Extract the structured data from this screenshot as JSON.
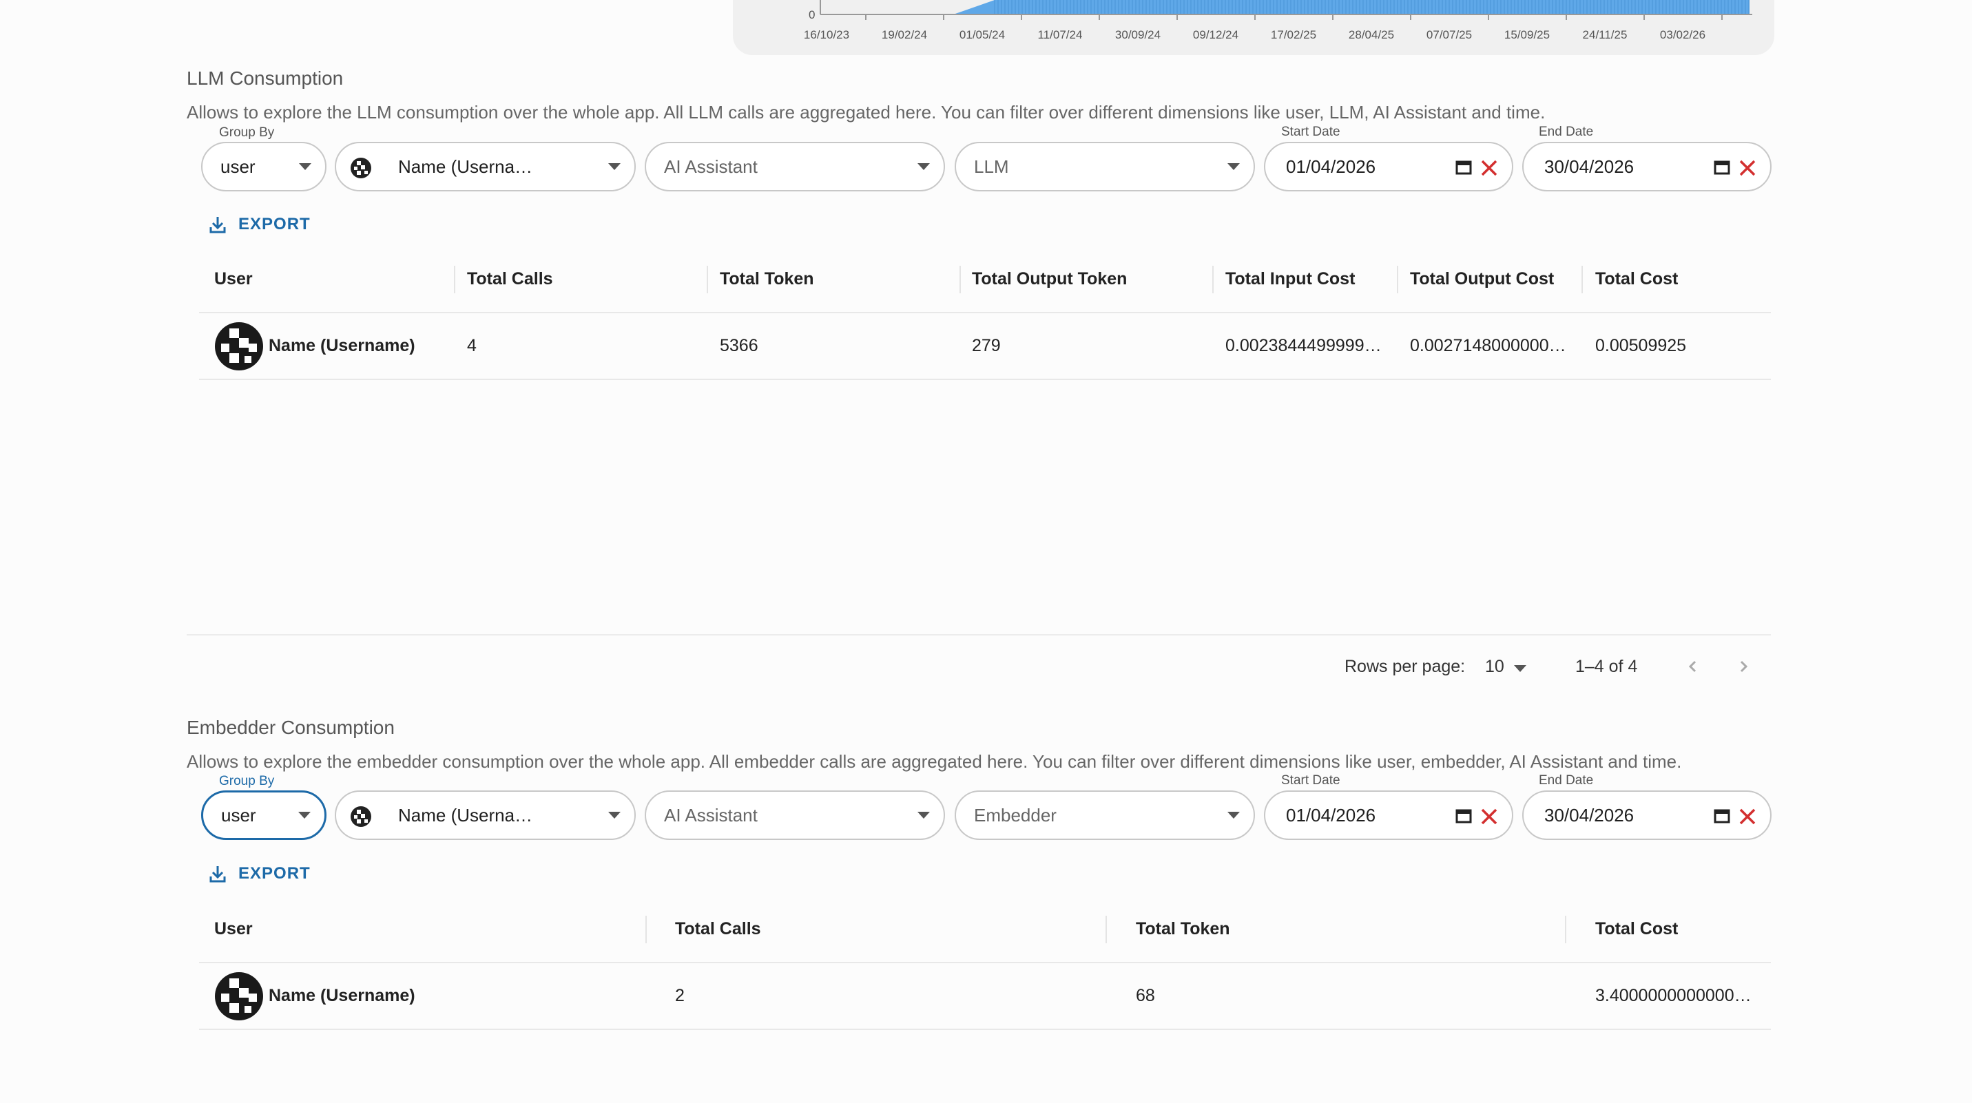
{
  "chart": {
    "y_tick": "0",
    "x_ticks": [
      "16/10/23",
      "19/02/24",
      "01/05/24",
      "11/07/24",
      "30/09/24",
      "09/12/24",
      "17/02/25",
      "28/04/25",
      "07/07/25",
      "15/09/25",
      "24/11/25",
      "03/02/26"
    ],
    "bar_color": "#5fa8e8"
  },
  "llm": {
    "title": "LLM Consumption",
    "description": "Allows to explore the LLM consumption over the whole app. All LLM calls are aggregated here. You can filter over different dimensions like user, LLM, AI Assistant and time.",
    "group_by_label": "Group By",
    "group_by_value": "user",
    "user_filter": "Name (Userna…",
    "assistant_placeholder": "AI Assistant",
    "model_placeholder": "LLM",
    "start_label": "Start Date",
    "start_value": "01/04/2026",
    "end_label": "End Date",
    "end_value": "30/04/2026",
    "export_label": "EXPORT",
    "columns": [
      "User",
      "Total Calls",
      "Total Token",
      "Total Output Token",
      "Total Input Cost",
      "Total Output Cost",
      "Total Cost"
    ],
    "rows": [
      {
        "user": "Name (Username)",
        "calls": "4",
        "token": "5366",
        "output_token": "279",
        "input_cost": "0.0023844499999…",
        "output_cost": "0.0027148000000…",
        "total_cost": "0.00509925"
      }
    ],
    "rows_per_page_label": "Rows per page:",
    "rows_per_page": "10",
    "range": "1–4 of 4"
  },
  "embedder": {
    "title": "Embedder Consumption",
    "description": "Allows to explore the embedder consumption over the whole app. All embedder calls are aggregated here. You can filter over different dimensions like user, embedder, AI Assistant and time.",
    "group_by_label": "Group By",
    "group_by_value": "user",
    "user_filter": "Name (Userna…",
    "assistant_placeholder": "AI Assistant",
    "model_placeholder": "Embedder",
    "start_label": "Start Date",
    "start_value": "01/04/2026",
    "end_label": "End Date",
    "end_value": "30/04/2026",
    "export_label": "EXPORT",
    "columns": [
      "User",
      "Total Calls",
      "Total Token",
      "Total Cost"
    ],
    "rows": [
      {
        "user": "Name (Username)",
        "calls": "2",
        "token": "68",
        "total_cost": "3.4000000000000…"
      }
    ]
  },
  "colors": {
    "accent": "#1d6aa8",
    "clear": "#d32f2f"
  }
}
